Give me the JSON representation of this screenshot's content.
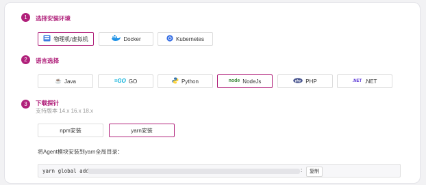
{
  "steps": [
    {
      "num": "1",
      "title": "选择安装环境"
    },
    {
      "num": "2",
      "title": "语言选择"
    },
    {
      "num": "3",
      "title": "下载探针",
      "subtitle": "支持版本 14.x 16.x 18.x"
    }
  ],
  "env_options": [
    {
      "label": "物理机/虚拟机",
      "icon": "server-icon",
      "selected": true
    },
    {
      "label": "Docker",
      "icon": "docker-icon",
      "selected": false
    },
    {
      "label": "Kubernetes",
      "icon": "kubernetes-icon",
      "selected": false
    }
  ],
  "lang_options": [
    {
      "label": "Java",
      "icon": "java-icon",
      "selected": false
    },
    {
      "label": "GO",
      "icon": "go-icon",
      "selected": false
    },
    {
      "label": "Python",
      "icon": "python-icon",
      "selected": false
    },
    {
      "label": "NodeJs",
      "icon": "nodejs-icon",
      "selected": true
    },
    {
      "label": "PHP",
      "icon": "php-icon",
      "selected": false
    },
    {
      "label": ".NET",
      "icon": "dotnet-icon",
      "selected": false
    }
  ],
  "install_tabs": [
    {
      "label": "npm安装",
      "selected": false
    },
    {
      "label": "yarn安装",
      "selected": true
    }
  ],
  "install_desc": "将Agent模块安装到yarn全局目录：",
  "command": {
    "prefix": "yarn global add",
    "copy_label": "复制"
  },
  "colors": {
    "accent": "#b0207a"
  }
}
